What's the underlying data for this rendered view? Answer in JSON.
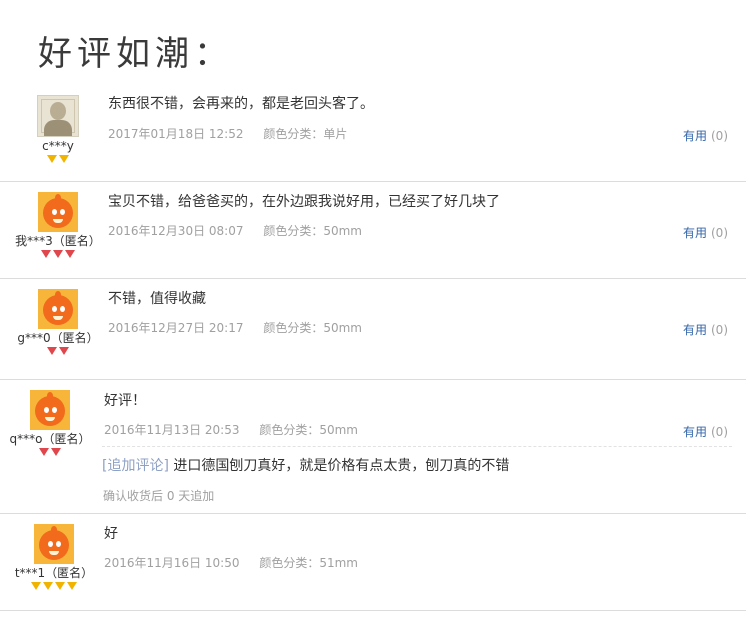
{
  "page": {
    "title": "好评如潮："
  },
  "reviews": [
    {
      "username": "c***y",
      "avatar": "photo-avatar",
      "rank_color": "gold",
      "rank_count": 2,
      "text": "东西很不错，会再来的，都是老回头客了。",
      "date": "2017年01月18日 12:52",
      "color_category": "颜色分类：单片",
      "useful_label": "有用",
      "useful_count": "(0)"
    },
    {
      "username": "我***3（匿名）",
      "avatar": "orange-mascot",
      "rank_color": "red",
      "rank_count": 3,
      "text": "宝贝不错，给爸爸买的，在外边跟我说好用，已经买了好几块了",
      "date": "2016年12月30日 08:07",
      "color_category": "颜色分类：50mm",
      "useful_label": "有用",
      "useful_count": "(0)"
    },
    {
      "username": "g***0（匿名）",
      "avatar": "orange-mascot",
      "rank_color": "red",
      "rank_count": 2,
      "text": "不错，值得收藏",
      "date": "2016年12月27日 20:17",
      "color_category": "颜色分类：50mm",
      "useful_label": "有用",
      "useful_count": "(0)"
    },
    {
      "username": "q***o（匿名）",
      "avatar": "orange-mascot",
      "rank_color": "red",
      "rank_count": 2,
      "text": "好评！",
      "date": "2016年11月13日 20:53",
      "color_category": "颜色分类：50mm",
      "useful_label": "有用",
      "useful_count": "(0)",
      "append_tag": "[追加评论]",
      "append_text": "进口德国刨刀真好，就是价格有点太贵，刨刀真的不错",
      "append_note": "确认收货后 0 天追加"
    },
    {
      "username": "t***1（匿名）",
      "avatar": "orange-mascot",
      "rank_color": "gold",
      "rank_count": 4,
      "text": "好",
      "date": "2016年11月16日 10:50",
      "color_category": "颜色分类：51mm"
    }
  ]
}
